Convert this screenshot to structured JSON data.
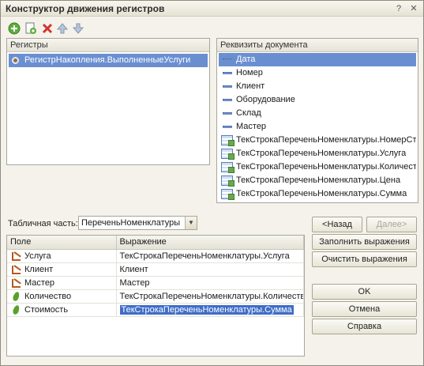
{
  "window": {
    "title": "Конструктор движения регистров"
  },
  "registers": {
    "header": "Регистры",
    "items": [
      "РегистрНакопления.ВыполненныеУслуги"
    ]
  },
  "requisites": {
    "header": "Реквизиты документа",
    "items": [
      {
        "label": "Дата",
        "kind": "attribute",
        "selected": true
      },
      {
        "label": "Номер",
        "kind": "attribute"
      },
      {
        "label": "Клиент",
        "kind": "attribute"
      },
      {
        "label": "Оборудование",
        "kind": "attribute"
      },
      {
        "label": "Склад",
        "kind": "attribute"
      },
      {
        "label": "Мастер",
        "kind": "attribute"
      },
      {
        "label": "ТекСтрокаПереченьНоменклатуры.НомерСтроки",
        "kind": "table-field"
      },
      {
        "label": "ТекСтрокаПереченьНоменклатуры.Услуга",
        "kind": "table-field"
      },
      {
        "label": "ТекСтрокаПереченьНоменклатуры.Количество",
        "kind": "table-field"
      },
      {
        "label": "ТекСтрокаПереченьНоменклатуры.Цена",
        "kind": "table-field"
      },
      {
        "label": "ТекСтрокаПереченьНоменклатуры.Сумма",
        "kind": "table-field"
      }
    ]
  },
  "tabular": {
    "label": "Табличная часть:",
    "value": "ПереченьНоменклатуры"
  },
  "grid": {
    "columns": [
      "Поле",
      "Выражение"
    ],
    "rows": [
      {
        "field": "Услуга",
        "kind": "dimension",
        "expression": "ТекСтрокаПереченьНоменклатуры.Услуга"
      },
      {
        "field": "Клиент",
        "kind": "dimension",
        "expression": "Клиент"
      },
      {
        "field": "Мастер",
        "kind": "dimension",
        "expression": "Мастер"
      },
      {
        "field": "Количество",
        "kind": "resource",
        "expression": "ТекСтрокаПереченьНоменклатуры.Количество"
      },
      {
        "field": "Стоимость",
        "kind": "resource",
        "expression": "ТекСтрокаПереченьНоменклатуры.Сумма",
        "editing": true
      }
    ]
  },
  "buttons": {
    "back": "<Назад",
    "next": "Далее>",
    "fill": "Заполнить выражения",
    "clear": "Очистить выражения",
    "ok": "OK",
    "cancel": "Отмена",
    "help": "Справка"
  },
  "colors": {
    "selection": "#6a8fd1",
    "edit_selection": "#3f6dc7",
    "window_bg": "#f4f2ea"
  }
}
